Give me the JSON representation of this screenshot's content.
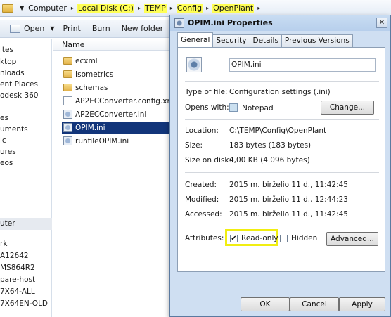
{
  "address_bar": {
    "crumbs": [
      "Computer",
      "Local Disk (C:)",
      "TEMP",
      "Config",
      "OpenPlant"
    ]
  },
  "toolbar": {
    "open_label": "Open",
    "print_label": "Print",
    "burn_label": "Burn",
    "new_folder_label": "New folder"
  },
  "nav_pane": {
    "items": [
      "ites",
      "ktop",
      "nloads",
      "ent Places",
      "odesk 360",
      "es",
      "uments",
      "ic",
      "ures",
      "eos",
      "uter",
      "rk",
      "A12642",
      "MS864R2",
      "pare-host",
      "7X64-ALL",
      "7X64EN-OLD"
    ]
  },
  "file_list": {
    "column_name": "Name",
    "files": [
      "ecxml",
      "Isometrics",
      "schemas",
      "AP2ECConverter.config.xml",
      "AP2ECConverter.ini",
      "OPIM.ini",
      "runfileOPIM.ini"
    ],
    "selected": "OPIM.ini"
  },
  "dialog": {
    "title": "OPIM.ini Properties",
    "close_glyph": "✕",
    "tabs": [
      "General",
      "Security",
      "Details",
      "Previous Versions"
    ],
    "active_tab": "General",
    "file_name": "OPIM.ini",
    "type_label": "Type of file:",
    "type_value": "Configuration settings (.ini)",
    "opens_label": "Opens with:",
    "opens_value": "Notepad",
    "change_button": "Change...",
    "location_label": "Location:",
    "location_value": "C:\\TEMP\\Config\\OpenPlant",
    "size_label": "Size:",
    "size_value": "183 bytes (183 bytes)",
    "size_disk_label": "Size on disk:",
    "size_disk_value": "4,00 KB (4.096 bytes)",
    "created_label": "Created:",
    "created_value": "2015 m. birželio 11 d., 11:42:45",
    "modified_label": "Modified:",
    "modified_value": "2015 m. birželio 11 d., 12:44:23",
    "accessed_label": "Accessed:",
    "accessed_value": "2015 m. birželio 11 d., 11:42:45",
    "attributes_label": "Attributes:",
    "readonly_label": "Read-only",
    "readonly_checked": true,
    "hidden_label": "Hidden",
    "hidden_checked": false,
    "advanced_button": "Advanced...",
    "ok_button": "OK",
    "cancel_button": "Cancel",
    "apply_button": "Apply",
    "check_glyph": "✔"
  },
  "colors": {
    "highlight_yellow": "#f1ee11",
    "selection_blue": "#12357a",
    "dialog_frame": "#cfdff2"
  }
}
